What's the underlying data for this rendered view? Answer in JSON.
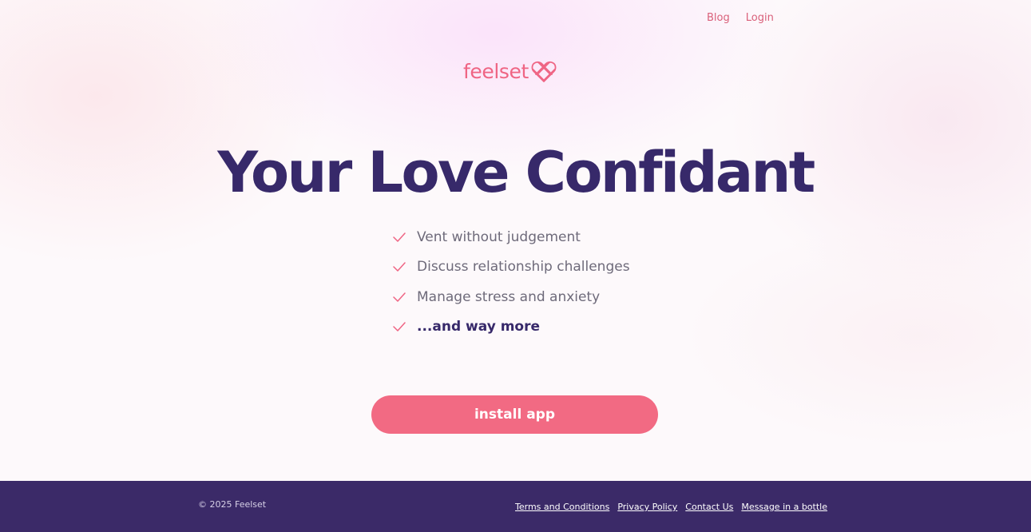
{
  "nav": {
    "blog": "Blog",
    "login": "Login"
  },
  "brand": {
    "name": "feelset",
    "icon": "heart-lattice-icon",
    "color": "#ef6584"
  },
  "hero": {
    "title": "Your Love Confidant",
    "title_color": "#37296a"
  },
  "features": [
    {
      "label": "Vent without judgement",
      "icon": "check-icon"
    },
    {
      "label": "Discuss relationship challenges",
      "icon": "check-icon"
    },
    {
      "label": "Manage stress and anxiety",
      "icon": "check-icon"
    },
    {
      "label": "...and way more",
      "icon": "check-icon"
    }
  ],
  "cta": {
    "label": "install app",
    "color": "#f26a83"
  },
  "footer": {
    "copyright": "© 2025 Feelset",
    "background": "#3b2a68",
    "links": [
      "Terms and Conditions",
      "Privacy Policy",
      "Contact Us",
      "Message in a bottle"
    ]
  }
}
